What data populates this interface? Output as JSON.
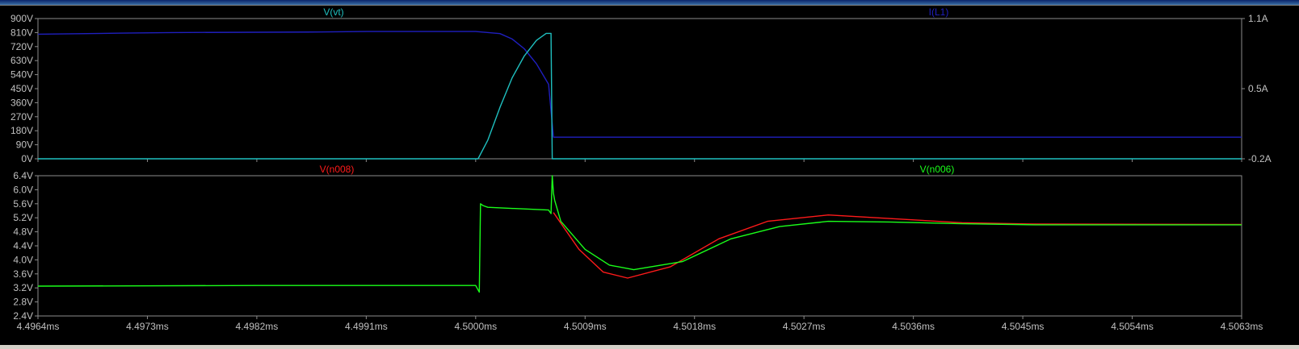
{
  "window": {
    "title": ""
  },
  "colors": {
    "background": "#000000",
    "axis": "#8c8c8c",
    "tick_label": "#c0c0c0",
    "vt": "#1fbfbf",
    "il1": "#1f1fbf",
    "n008": "#ff1a1a",
    "n006": "#1aff1a"
  },
  "chart_data": [
    {
      "type": "line",
      "title": "",
      "x_ticks": [
        "4.4964ms",
        "4.4973ms",
        "4.4982ms",
        "4.4991ms",
        "4.5000ms",
        "4.5009ms",
        "4.5018ms",
        "4.5027ms",
        "4.5036ms",
        "4.5045ms",
        "4.5054ms",
        "4.5063ms"
      ],
      "xlim": [
        4.4964,
        4.5063
      ],
      "left_axis": {
        "ylim": [
          0,
          900
        ],
        "ticks": [
          "900V",
          "810V",
          "720V",
          "630V",
          "540V",
          "450V",
          "360V",
          "270V",
          "180V",
          "90V",
          "0V"
        ]
      },
      "right_axis": {
        "ylim": [
          -0.2,
          1.1
        ],
        "ticks": [
          "1.1A",
          "0.5A",
          "-0.2A"
        ]
      },
      "grid": false,
      "series": [
        {
          "name": "V(vt)",
          "axis": "left",
          "color": "#1fbfbf",
          "x": [
            4.4964,
            4.50002,
            4.5001,
            4.5002,
            4.5003,
            4.5004,
            4.5005,
            4.50058,
            4.50062,
            4.50063,
            4.5063
          ],
          "y": [
            0,
            0,
            120,
            330,
            520,
            660,
            760,
            805,
            805,
            0,
            0
          ]
        },
        {
          "name": "I(L1)",
          "axis": "right",
          "color": "#1f1fbf",
          "x": [
            4.4964,
            4.4971,
            4.4975,
            4.4987,
            4.4991,
            4.5,
            4.5002,
            4.5003,
            4.5004,
            4.5005,
            4.5006,
            4.50064,
            4.5018,
            4.5063
          ],
          "y": [
            0.955,
            0.965,
            0.97,
            0.975,
            0.98,
            0.98,
            0.96,
            0.91,
            0.82,
            0.68,
            0.49,
            0.0,
            0.0,
            0.0
          ]
        },
        {
          "name": "V(n008)",
          "axis": "left",
          "color": "#ff1a1a",
          "x": [
            4.50064,
            4.50085,
            4.50105,
            4.50125,
            4.5016,
            4.502,
            4.5024,
            4.5029,
            4.5034,
            4.504,
            4.5046,
            4.5063
          ],
          "y": [
            5.35,
            4.3,
            3.65,
            3.48,
            3.8,
            4.6,
            5.1,
            5.28,
            5.18,
            5.06,
            5.02,
            5.01
          ]
        },
        {
          "name": "V(n006)",
          "axis": "left",
          "color": "#1aff1a",
          "x": [
            4.4964,
            4.4982,
            4.5,
            4.50003,
            4.50004,
            4.50006,
            4.5001,
            4.5006,
            4.50062,
            4.50063,
            4.50064,
            4.50065,
            4.5007,
            4.5009,
            4.5011,
            4.5013,
            4.5017,
            4.5021,
            4.5025,
            4.5029,
            4.5034,
            4.504,
            4.5046,
            4.5063
          ],
          "y": [
            3.25,
            3.27,
            3.27,
            3.08,
            5.6,
            5.55,
            5.5,
            5.42,
            5.32,
            6.45,
            5.9,
            5.7,
            5.1,
            4.3,
            3.85,
            3.72,
            3.95,
            4.6,
            4.95,
            5.1,
            5.08,
            5.03,
            5.0,
            5.0
          ]
        }
      ]
    },
    {
      "type": "line",
      "title": "",
      "x_ticks": [
        "4.4964ms",
        "4.4973ms",
        "4.4982ms",
        "4.4991ms",
        "4.5000ms",
        "4.5009ms",
        "4.5018ms",
        "4.5027ms",
        "4.5036ms",
        "4.5045ms",
        "4.5054ms",
        "4.5063ms"
      ],
      "xlim": [
        4.4964,
        4.5063
      ],
      "left_axis": {
        "ylim": [
          2.4,
          6.4
        ],
        "ticks": [
          "6.4V",
          "6.0V",
          "5.6V",
          "5.2V",
          "4.8V",
          "4.4V",
          "4.0V",
          "3.6V",
          "3.2V",
          "2.8V",
          "2.4V"
        ]
      },
      "grid": false,
      "series": [
        {
          "name": "V(n008)",
          "color": "#ff1a1a",
          "x": [
            4.50064,
            4.50085,
            4.50105,
            4.50125,
            4.5016,
            4.502,
            4.5024,
            4.5029,
            4.5034,
            4.504,
            4.5046,
            4.5063
          ],
          "y": [
            5.35,
            4.3,
            3.65,
            3.48,
            3.8,
            4.6,
            5.1,
            5.28,
            5.18,
            5.06,
            5.02,
            5.01
          ]
        },
        {
          "name": "V(n006)",
          "color": "#1aff1a",
          "x": [
            4.4964,
            4.4982,
            4.5,
            4.50003,
            4.50004,
            4.50006,
            4.5001,
            4.5006,
            4.50062,
            4.50063,
            4.50064,
            4.50065,
            4.5007,
            4.5009,
            4.5011,
            4.5013,
            4.5017,
            4.5021,
            4.5025,
            4.5029,
            4.5034,
            4.504,
            4.5046,
            4.5063
          ],
          "y": [
            3.25,
            3.27,
            3.27,
            3.08,
            5.6,
            5.55,
            5.5,
            5.42,
            5.32,
            6.45,
            5.9,
            5.7,
            5.1,
            4.3,
            3.85,
            3.72,
            3.95,
            4.6,
            4.95,
            5.1,
            5.08,
            5.03,
            5.0,
            5.0
          ]
        }
      ]
    }
  ]
}
